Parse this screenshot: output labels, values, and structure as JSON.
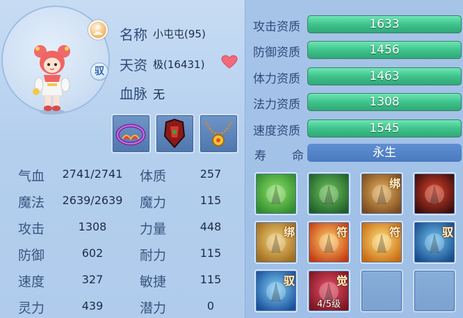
{
  "pet": {
    "name_label": "名称",
    "name_value": "小屯屯(95)",
    "talent_label": "天资",
    "talent_value": "极(16431)",
    "bloodline_label": "血脉",
    "bloodline_value": "无",
    "badge_mid": "驭"
  },
  "equipment": [
    "ring-equipment",
    "armor-equipment",
    "necklace-equipment"
  ],
  "stats_left": [
    {
      "label": "气血",
      "value": "2741/2741"
    },
    {
      "label": "魔法",
      "value": "2639/2639"
    },
    {
      "label": "攻击",
      "value": "1308"
    },
    {
      "label": "防御",
      "value": "602"
    },
    {
      "label": "速度",
      "value": "327"
    },
    {
      "label": "灵力",
      "value": "439"
    }
  ],
  "stats_right": [
    {
      "label": "体质",
      "value": "257"
    },
    {
      "label": "魔力",
      "value": "115"
    },
    {
      "label": "力量",
      "value": "448"
    },
    {
      "label": "耐力",
      "value": "115"
    },
    {
      "label": "敏捷",
      "value": "115"
    },
    {
      "label": "潜力",
      "value": "0"
    }
  ],
  "aptitudes": [
    {
      "label": "攻击资质",
      "value": "1633",
      "fill": 1.0
    },
    {
      "label": "防御资质",
      "value": "1456",
      "fill": 1.0
    },
    {
      "label": "体力资质",
      "value": "1463",
      "fill": 1.0
    },
    {
      "label": "法力资质",
      "value": "1308",
      "fill": 1.0
    },
    {
      "label": "速度资质",
      "value": "1545",
      "fill": 1.0
    }
  ],
  "life": {
    "label_1": "寿",
    "label_2": "命",
    "value": "永生"
  },
  "skills": [
    {
      "tag": "",
      "level": "",
      "colors": [
        "#2f8a2a",
        "#8fe26a"
      ]
    },
    {
      "tag": "",
      "level": "",
      "colors": [
        "#1f5e2a",
        "#6fc65a"
      ]
    },
    {
      "tag": "绑",
      "level": "",
      "colors": [
        "#7a4a1c",
        "#e9b361"
      ]
    },
    {
      "tag": "",
      "level": "",
      "colors": [
        "#3a0c0c",
        "#e0452a"
      ]
    },
    {
      "tag": "绑",
      "level": "",
      "colors": [
        "#a06a1c",
        "#f3d27a"
      ]
    },
    {
      "tag": "符",
      "level": "",
      "colors": [
        "#c43a12",
        "#ffd36a"
      ]
    },
    {
      "tag": "符",
      "level": "",
      "colors": [
        "#c86a10",
        "#ffe07a"
      ]
    },
    {
      "tag": "驭",
      "level": "",
      "colors": [
        "#184b8a",
        "#6fc3f2"
      ]
    },
    {
      "tag": "驭",
      "level": "",
      "colors": [
        "#1a4f9a",
        "#7fd0f6"
      ]
    },
    {
      "tag": "觉",
      "level": "4/5级",
      "colors": [
        "#7a1420",
        "#e8506a"
      ]
    },
    {
      "tag": "",
      "level": "",
      "colors": null
    },
    {
      "tag": "",
      "level": "",
      "colors": null
    }
  ]
}
